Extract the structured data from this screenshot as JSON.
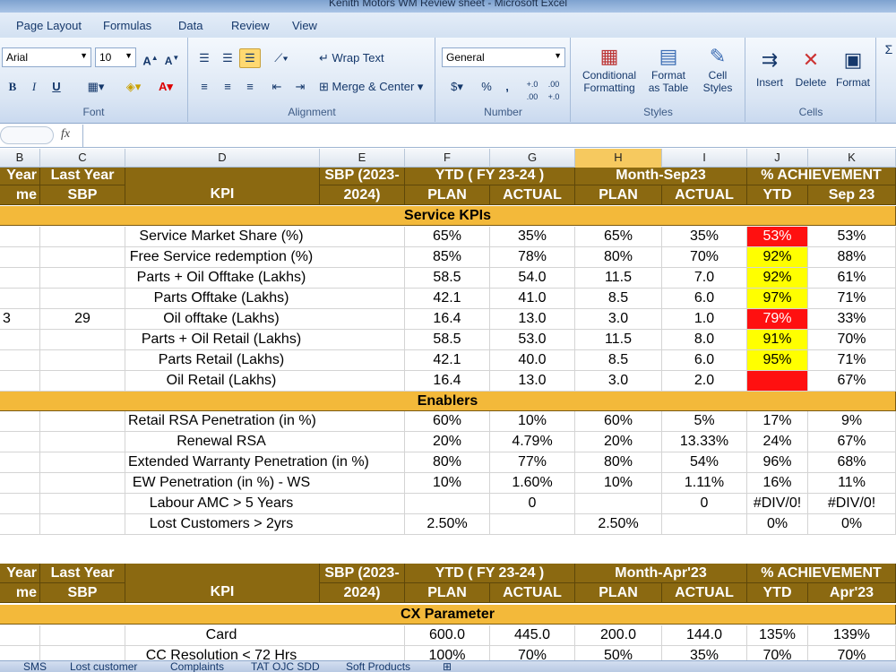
{
  "window": {
    "title": "Kenith Motors WM Review sheet  -  Microsoft Excel"
  },
  "ribbon_tabs": [
    "Page Layout",
    "Formulas",
    "Data",
    "Review",
    "View"
  ],
  "ribbon": {
    "font": {
      "name": "Arial",
      "size": "10",
      "label": "Font",
      "bold": "B",
      "italic": "I",
      "underline": "U"
    },
    "alignment": {
      "wrap_text": "Wrap Text",
      "merge_center": "Merge & Center",
      "label": "Alignment"
    },
    "number": {
      "format": "General",
      "label": "Number",
      "percent": "%",
      "comma": ",",
      "inc_decimal": "+.0\n.00",
      "dec_decimal": ".00\n+.0"
    },
    "styles": {
      "conditional": "Conditional\nFormatting",
      "format_table": "Format\nas Table",
      "cell_styles": "Cell\nStyles",
      "label": "Styles"
    },
    "cells": {
      "insert": "Insert",
      "delete": "Delete",
      "format": "Format",
      "label": "Cells"
    }
  },
  "formula_bar": {
    "fx": "fx",
    "value": ""
  },
  "columns": [
    "B",
    "C",
    "D",
    "E",
    "F",
    "G",
    "H",
    "I",
    "J",
    "K"
  ],
  "selected_column": "H",
  "header1": {
    "b1": "Year",
    "b2": "me",
    "c1": "Last Year",
    "c2": "SBP",
    "d": "KPI",
    "e1": "SBP (2023-",
    "e2": "2024)",
    "ytd": "YTD ( FY 23-24 )",
    "month": "Month-Sep23",
    "ach": "% ACHIEVEMENT",
    "plan": "PLAN",
    "actual": "ACTUAL",
    "plan2": "PLAN",
    "actual2": "ACTUAL",
    "ach_ytd": "YTD",
    "ach_month": "Sep 23"
  },
  "section_service": "Service KPIs",
  "service_rows": [
    {
      "b": "",
      "c": "",
      "kpi": "Service Market Share (%)",
      "f": "65%",
      "g": "35%",
      "h": "65%",
      "i": "35%",
      "j": "53%",
      "k": "53%",
      "jc": "red"
    },
    {
      "b": "",
      "c": "",
      "kpi": "Free Service redemption (%)",
      "f": "85%",
      "g": "78%",
      "h": "80%",
      "i": "70%",
      "j": "92%",
      "k": "88%",
      "jc": "yel"
    },
    {
      "b": "",
      "c": "",
      "kpi": "Parts + Oil Offtake (Lakhs)",
      "f": "58.5",
      "g": "54.0",
      "h": "11.5",
      "i": "7.0",
      "j": "92%",
      "k": "61%",
      "jc": "yel"
    },
    {
      "b": "",
      "c": "",
      "kpi": "Parts Offtake (Lakhs)",
      "f": "42.1",
      "g": "41.0",
      "h": "8.5",
      "i": "6.0",
      "j": "97%",
      "k": "71%",
      "jc": "yel"
    },
    {
      "b": "3",
      "c": "29",
      "kpi": "Oil offtake (Lakhs)",
      "f": "16.4",
      "g": "13.0",
      "h": "3.0",
      "i": "1.0",
      "j": "79%",
      "k": "33%",
      "jc": "red"
    },
    {
      "b": "",
      "c": "",
      "kpi": "Parts + Oil Retail (Lakhs)",
      "f": "58.5",
      "g": "53.0",
      "h": "11.5",
      "i": "8.0",
      "j": "91%",
      "k": "70%",
      "jc": "yel"
    },
    {
      "b": "",
      "c": "",
      "kpi": "Parts Retail (Lakhs)",
      "f": "42.1",
      "g": "40.0",
      "h": "8.5",
      "i": "6.0",
      "j": "95%",
      "k": "71%",
      "jc": "yel"
    },
    {
      "b": "",
      "c": "",
      "kpi": "Oil Retail (Lakhs)",
      "f": "16.4",
      "g": "13.0",
      "h": "3.0",
      "i": "2.0",
      "j": "",
      "k": "67%",
      "jc": "red"
    }
  ],
  "section_enablers": "Enablers",
  "enabler_rows": [
    {
      "kpi": "Retail RSA Penetration (in %)",
      "f": "60%",
      "g": "10%",
      "h": "60%",
      "i": "5%",
      "j": "17%",
      "k": "9%"
    },
    {
      "kpi": "Renewal RSA",
      "f": "20%",
      "g": "4.79%",
      "h": "20%",
      "i": "13.33%",
      "j": "24%",
      "k": "67%"
    },
    {
      "kpi": "Extended Warranty Penetration (in %)",
      "f": "80%",
      "g": "77%",
      "h": "80%",
      "i": "54%",
      "j": "96%",
      "k": "68%"
    },
    {
      "kpi": "EW Penetration (in %) - WS",
      "f": "10%",
      "g": "1.60%",
      "h": "10%",
      "i": "1.11%",
      "j": "16%",
      "k": "11%"
    },
    {
      "kpi": "Labour AMC > 5 Years",
      "f": "",
      "g": "0",
      "h": "",
      "i": "0",
      "j": "#DIV/0!",
      "k": "#DIV/0!"
    },
    {
      "kpi": "Lost Customers > 2yrs",
      "f": "2.50%",
      "g": "",
      "h": "2.50%",
      "i": "",
      "j": "0%",
      "k": "0%"
    }
  ],
  "header2": {
    "b1": "Year",
    "b2": "me",
    "c1": "Last Year",
    "c2": "SBP",
    "d": "KPI",
    "e1": "SBP (2023-",
    "e2": "2024)",
    "ytd": "YTD ( FY 23-24 )",
    "month": "Month-Apr'23",
    "ach": "% ACHIEVEMENT",
    "plan": "PLAN",
    "actual": "ACTUAL",
    "plan2": "PLAN",
    "actual2": "ACTUAL",
    "ach_ytd": "YTD",
    "ach_month": "Apr'23"
  },
  "section_cx": "CX Parameter",
  "cx_rows": [
    {
      "kpi": "Card",
      "f": "600.0",
      "g": "445.0",
      "h": "200.0",
      "i": "144.0",
      "j": "135%",
      "k": "139%"
    },
    {
      "kpi": "CC Resolution < 72 Hrs",
      "f": "100%",
      "g": "70%",
      "h": "50%",
      "i": "35%",
      "j": "70%",
      "k": "70%"
    }
  ],
  "sheet_tabs": [
    "SMS",
    "Lost customer",
    "Complaints",
    "TAT OJC SDD",
    "Soft Products"
  ]
}
